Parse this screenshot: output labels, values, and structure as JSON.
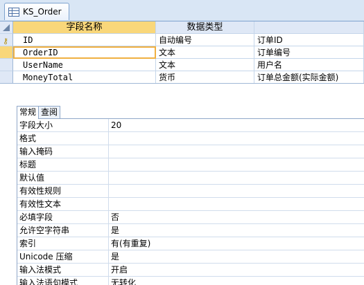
{
  "window": {
    "tab_title": "KS_Order",
    "tab_icon": "table-icon"
  },
  "grid": {
    "headers": {
      "field_name": "字段名称",
      "data_type": "数据类型",
      "description": ""
    },
    "rows": [
      {
        "name": "ID",
        "type": "自动编号",
        "desc": "订单ID",
        "primary_key": true
      },
      {
        "name": "OrderID",
        "type": "文本",
        "desc": "订单编号",
        "current": true
      },
      {
        "name": "UserName",
        "type": "文本",
        "desc": "用户名"
      },
      {
        "name": "MoneyTotal",
        "type": "货币",
        "desc": "订单总金额(实际金额)"
      }
    ]
  },
  "props": {
    "tabs": [
      "常规",
      "查阅"
    ],
    "active_tab": "常规",
    "rows": [
      {
        "label": "字段大小",
        "value": "20"
      },
      {
        "label": "格式",
        "value": ""
      },
      {
        "label": "输入掩码",
        "value": ""
      },
      {
        "label": "标题",
        "value": ""
      },
      {
        "label": "默认值",
        "value": ""
      },
      {
        "label": "有效性规则",
        "value": ""
      },
      {
        "label": "有效性文本",
        "value": ""
      },
      {
        "label": "必填字段",
        "value": "否"
      },
      {
        "label": "允许空字符串",
        "value": "是"
      },
      {
        "label": "索引",
        "value": "有(有重复)"
      },
      {
        "label": "Unicode 压缩",
        "value": "是"
      },
      {
        "label": "输入法模式",
        "value": "开启"
      },
      {
        "label": "输入法语句模式",
        "value": "无转化"
      }
    ]
  },
  "colors": {
    "header_bg": "#dfe8f6",
    "selected_header": "#f9d77a",
    "grid_line": "#c5d6ea"
  }
}
